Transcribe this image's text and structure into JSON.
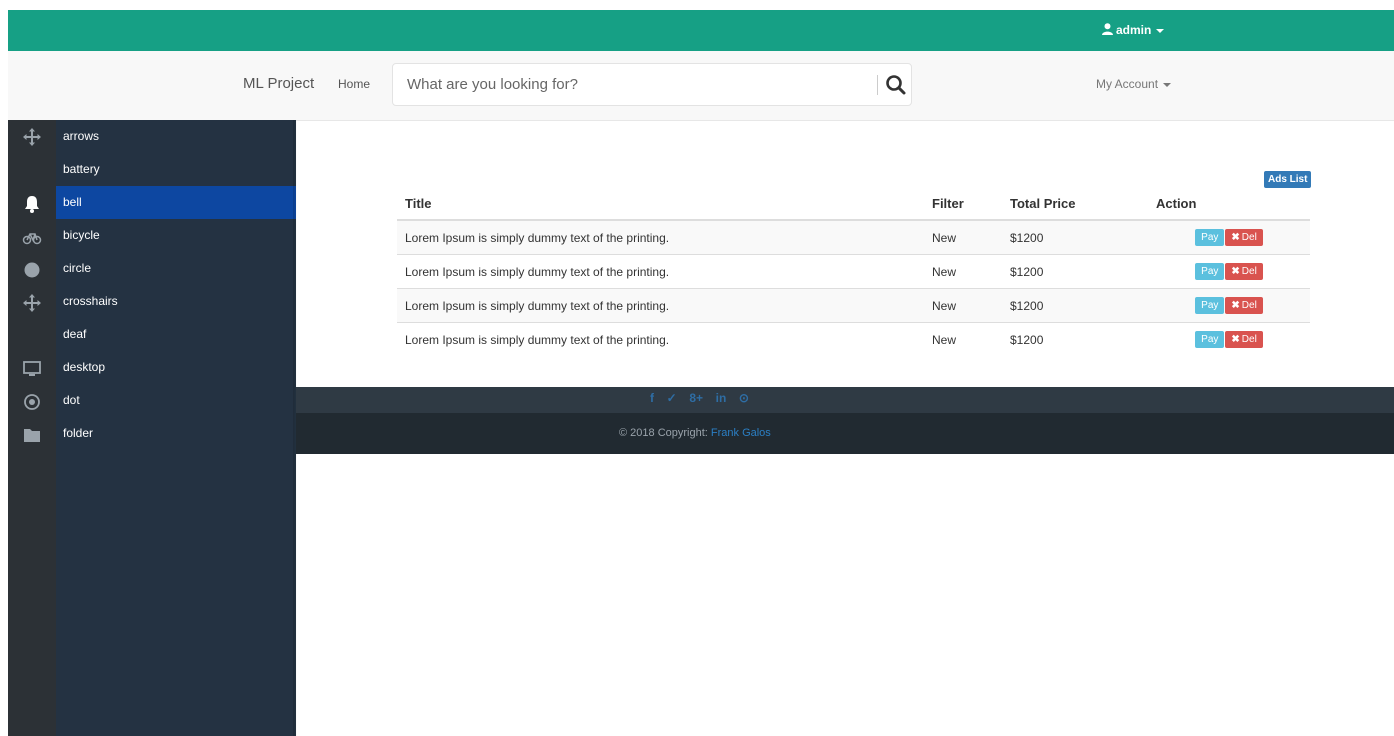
{
  "topbar": {
    "user_label": "admin"
  },
  "navbar": {
    "brand": "ML Project",
    "home": "Home",
    "search_placeholder": "What are you looking for?",
    "account": "My Account"
  },
  "sidebar": {
    "items": [
      {
        "label": "arrows",
        "icon": "arrows-icon",
        "active": false
      },
      {
        "label": "battery",
        "icon": "battery-icon",
        "active": false
      },
      {
        "label": "bell",
        "icon": "bell-icon",
        "active": true
      },
      {
        "label": "bicycle",
        "icon": "bicycle-icon",
        "active": false
      },
      {
        "label": "circle",
        "icon": "circle-icon",
        "active": false
      },
      {
        "label": "crosshairs",
        "icon": "crosshairs-icon",
        "active": false
      },
      {
        "label": "deaf",
        "icon": "deaf-icon",
        "active": false
      },
      {
        "label": "desktop",
        "icon": "desktop-icon",
        "active": false
      },
      {
        "label": "dot",
        "icon": "dot-circle-icon",
        "active": false
      },
      {
        "label": "folder",
        "icon": "folder-icon",
        "active": false
      }
    ]
  },
  "main": {
    "ads_list_button": "Ads List",
    "table": {
      "headers": {
        "title": "Title",
        "filter": "Filter",
        "price": "Total Price",
        "action": "Action"
      },
      "rows": [
        {
          "title": "Lorem Ipsum is simply dummy text of the printing.",
          "filter": "New",
          "price": "$1200"
        },
        {
          "title": "Lorem Ipsum is simply dummy text of the printing.",
          "filter": "New",
          "price": "$1200"
        },
        {
          "title": "Lorem Ipsum is simply dummy text of the printing.",
          "filter": "New",
          "price": "$1200"
        },
        {
          "title": "Lorem Ipsum is simply dummy text of the printing.",
          "filter": "New",
          "price": "$1200"
        }
      ],
      "pay_label": "Pay",
      "del_label": "Del"
    }
  },
  "footer": {
    "socials": [
      "f",
      "✓",
      "8+",
      "in",
      "⊙"
    ],
    "copyright": "© 2018 Copyright: ",
    "author": "Frank Galos"
  },
  "colors": {
    "topbar": "#16a085",
    "sidebar": "#243242",
    "active_item": "#0d47a1",
    "pay": "#5bc0de",
    "del": "#d9534f"
  }
}
